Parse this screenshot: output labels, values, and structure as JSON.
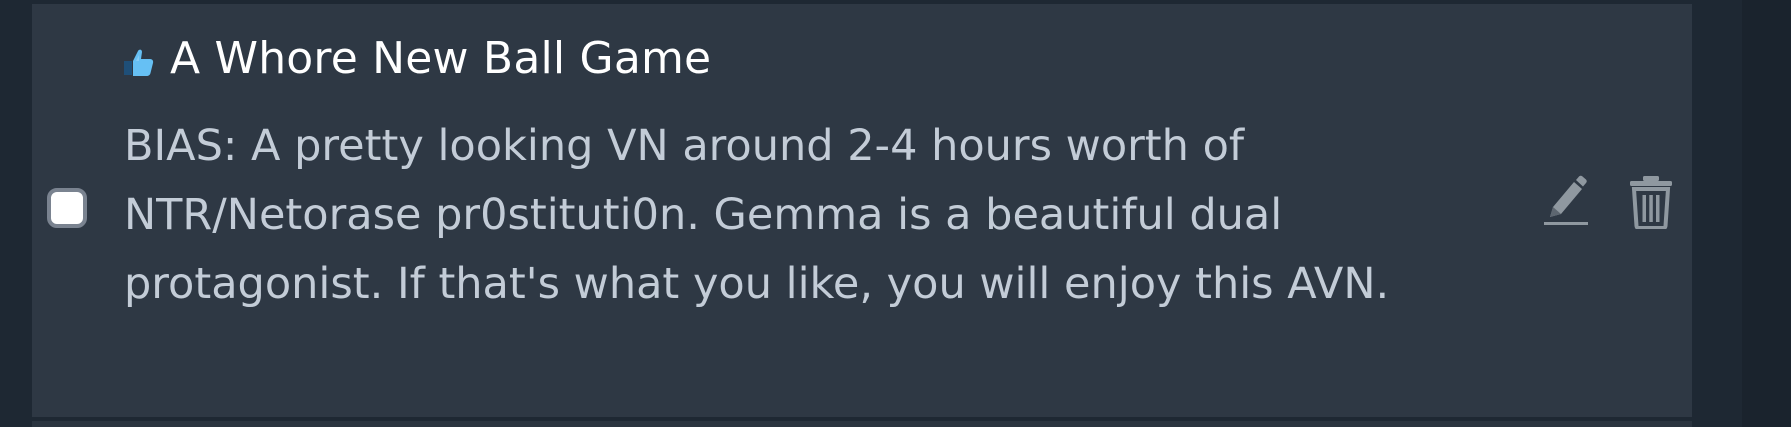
{
  "review": {
    "title": "A Whore New Ball Game",
    "rating_icon": "thumbs-up-icon",
    "body": "BIAS: A pretty looking VN around 2-4 hours worth of NTR/Netorase pr0stituti0n. Gemma is a beautiful dual protagonist. If that's what you like, you will enjoy this AVN.",
    "selected": false
  },
  "actions": {
    "edit_icon": "pencil-icon",
    "delete_icon": "trash-icon"
  },
  "colors": {
    "page_background": "#1e2833",
    "card_background": "#2e3844",
    "title_text": "#ffffff",
    "body_text": "#c3ccd7",
    "thumb_icon": "#66c0f4",
    "action_icon": "#8f98a0"
  }
}
